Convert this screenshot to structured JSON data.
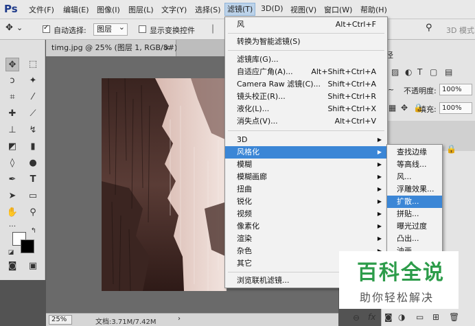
{
  "app": {
    "logo": "Ps"
  },
  "menubar": {
    "items": [
      "文件(F)",
      "编辑(E)",
      "图像(I)",
      "图层(L)",
      "文字(Y)",
      "选择(S)",
      "滤镜(T)",
      "3D(D)",
      "视图(V)",
      "窗口(W)",
      "帮助(H)"
    ]
  },
  "options_bar": {
    "auto_select_label": "自动选择:",
    "auto_select_checked": true,
    "layer_dropdown_value": "图层",
    "show_transform_label": "显示变换控件",
    "show_transform_checked": false,
    "mode_3d_label": "3D 模式"
  },
  "document": {
    "tab_title": "timg.jpg @ 25% (图层 1, RGB/8#) *",
    "tab_close": "×",
    "zoom": "25%",
    "doc_info": "文档:3.71M/7.42M",
    "status_arrow": "›"
  },
  "right_panel": {
    "panel_label": "径",
    "opacity_label": "不透明度:",
    "opacity_value": "100%",
    "fill_label": "填充:",
    "fill_value": "100%",
    "mode_prefix": "~"
  },
  "filter_menu": {
    "items": [
      {
        "label": "风",
        "shortcut": "Alt+Ctrl+F"
      },
      {
        "label": "转换为智能滤镜(S)",
        "shortcut": ""
      },
      {
        "label": "滤镜库(G)...",
        "shortcut": ""
      },
      {
        "label": "自适应广角(A)...",
        "shortcut": "Alt+Shift+Ctrl+A"
      },
      {
        "label": "Camera Raw 滤镜(C)...",
        "shortcut": "Shift+Ctrl+A"
      },
      {
        "label": "镜头校正(R)...",
        "shortcut": "Shift+Ctrl+R"
      },
      {
        "label": "液化(L)...",
        "shortcut": "Shift+Ctrl+X"
      },
      {
        "label": "消失点(V)...",
        "shortcut": "Alt+Ctrl+V"
      },
      {
        "label": "3D",
        "shortcut": ""
      },
      {
        "label": "风格化",
        "shortcut": ""
      },
      {
        "label": "模糊",
        "shortcut": ""
      },
      {
        "label": "模糊画廊",
        "shortcut": ""
      },
      {
        "label": "扭曲",
        "shortcut": ""
      },
      {
        "label": "锐化",
        "shortcut": ""
      },
      {
        "label": "视频",
        "shortcut": ""
      },
      {
        "label": "像素化",
        "shortcut": ""
      },
      {
        "label": "渲染",
        "shortcut": ""
      },
      {
        "label": "杂色",
        "shortcut": ""
      },
      {
        "label": "其它",
        "shortcut": ""
      },
      {
        "label": "浏览联机滤镜...",
        "shortcut": ""
      }
    ],
    "highlighted": "风格化"
  },
  "stylize_submenu": {
    "items": [
      "查找边缘",
      "等高线...",
      "风...",
      "浮雕效果...",
      "扩散...",
      "拼贴...",
      "曝光过度",
      "凸出...",
      "油画..."
    ],
    "highlighted": "扩散..."
  },
  "watermark": {
    "title": "百科全说",
    "subtitle": "助你轻松解决"
  },
  "colors": {
    "menu_highlight": "#3b86d6",
    "workspace": "#535353",
    "foreground": "#ffffff",
    "background": "#000000"
  }
}
